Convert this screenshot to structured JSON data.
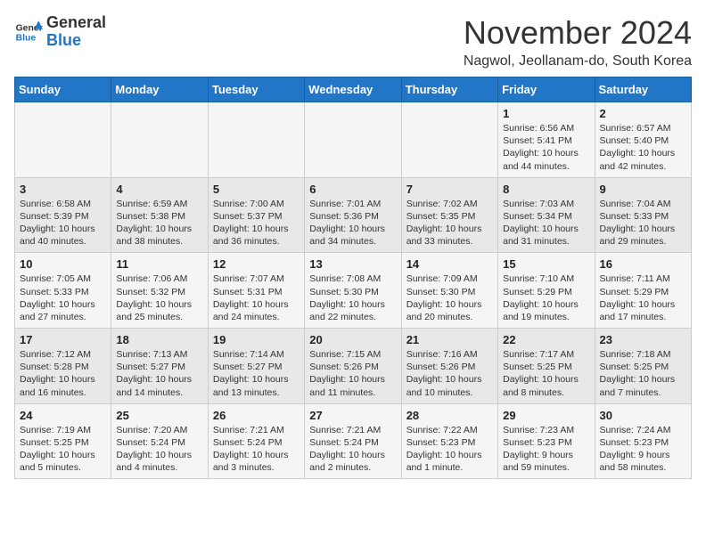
{
  "header": {
    "logo_general": "General",
    "logo_blue": "Blue",
    "month_title": "November 2024",
    "location": "Nagwol, Jeollanam-do, South Korea"
  },
  "weekdays": [
    "Sunday",
    "Monday",
    "Tuesday",
    "Wednesday",
    "Thursday",
    "Friday",
    "Saturday"
  ],
  "weeks": [
    [
      {
        "day": "",
        "info": ""
      },
      {
        "day": "",
        "info": ""
      },
      {
        "day": "",
        "info": ""
      },
      {
        "day": "",
        "info": ""
      },
      {
        "day": "",
        "info": ""
      },
      {
        "day": "1",
        "info": "Sunrise: 6:56 AM\nSunset: 5:41 PM\nDaylight: 10 hours\nand 44 minutes."
      },
      {
        "day": "2",
        "info": "Sunrise: 6:57 AM\nSunset: 5:40 PM\nDaylight: 10 hours\nand 42 minutes."
      }
    ],
    [
      {
        "day": "3",
        "info": "Sunrise: 6:58 AM\nSunset: 5:39 PM\nDaylight: 10 hours\nand 40 minutes."
      },
      {
        "day": "4",
        "info": "Sunrise: 6:59 AM\nSunset: 5:38 PM\nDaylight: 10 hours\nand 38 minutes."
      },
      {
        "day": "5",
        "info": "Sunrise: 7:00 AM\nSunset: 5:37 PM\nDaylight: 10 hours\nand 36 minutes."
      },
      {
        "day": "6",
        "info": "Sunrise: 7:01 AM\nSunset: 5:36 PM\nDaylight: 10 hours\nand 34 minutes."
      },
      {
        "day": "7",
        "info": "Sunrise: 7:02 AM\nSunset: 5:35 PM\nDaylight: 10 hours\nand 33 minutes."
      },
      {
        "day": "8",
        "info": "Sunrise: 7:03 AM\nSunset: 5:34 PM\nDaylight: 10 hours\nand 31 minutes."
      },
      {
        "day": "9",
        "info": "Sunrise: 7:04 AM\nSunset: 5:33 PM\nDaylight: 10 hours\nand 29 minutes."
      }
    ],
    [
      {
        "day": "10",
        "info": "Sunrise: 7:05 AM\nSunset: 5:33 PM\nDaylight: 10 hours\nand 27 minutes."
      },
      {
        "day": "11",
        "info": "Sunrise: 7:06 AM\nSunset: 5:32 PM\nDaylight: 10 hours\nand 25 minutes."
      },
      {
        "day": "12",
        "info": "Sunrise: 7:07 AM\nSunset: 5:31 PM\nDaylight: 10 hours\nand 24 minutes."
      },
      {
        "day": "13",
        "info": "Sunrise: 7:08 AM\nSunset: 5:30 PM\nDaylight: 10 hours\nand 22 minutes."
      },
      {
        "day": "14",
        "info": "Sunrise: 7:09 AM\nSunset: 5:30 PM\nDaylight: 10 hours\nand 20 minutes."
      },
      {
        "day": "15",
        "info": "Sunrise: 7:10 AM\nSunset: 5:29 PM\nDaylight: 10 hours\nand 19 minutes."
      },
      {
        "day": "16",
        "info": "Sunrise: 7:11 AM\nSunset: 5:29 PM\nDaylight: 10 hours\nand 17 minutes."
      }
    ],
    [
      {
        "day": "17",
        "info": "Sunrise: 7:12 AM\nSunset: 5:28 PM\nDaylight: 10 hours\nand 16 minutes."
      },
      {
        "day": "18",
        "info": "Sunrise: 7:13 AM\nSunset: 5:27 PM\nDaylight: 10 hours\nand 14 minutes."
      },
      {
        "day": "19",
        "info": "Sunrise: 7:14 AM\nSunset: 5:27 PM\nDaylight: 10 hours\nand 13 minutes."
      },
      {
        "day": "20",
        "info": "Sunrise: 7:15 AM\nSunset: 5:26 PM\nDaylight: 10 hours\nand 11 minutes."
      },
      {
        "day": "21",
        "info": "Sunrise: 7:16 AM\nSunset: 5:26 PM\nDaylight: 10 hours\nand 10 minutes."
      },
      {
        "day": "22",
        "info": "Sunrise: 7:17 AM\nSunset: 5:25 PM\nDaylight: 10 hours\nand 8 minutes."
      },
      {
        "day": "23",
        "info": "Sunrise: 7:18 AM\nSunset: 5:25 PM\nDaylight: 10 hours\nand 7 minutes."
      }
    ],
    [
      {
        "day": "24",
        "info": "Sunrise: 7:19 AM\nSunset: 5:25 PM\nDaylight: 10 hours\nand 5 minutes."
      },
      {
        "day": "25",
        "info": "Sunrise: 7:20 AM\nSunset: 5:24 PM\nDaylight: 10 hours\nand 4 minutes."
      },
      {
        "day": "26",
        "info": "Sunrise: 7:21 AM\nSunset: 5:24 PM\nDaylight: 10 hours\nand 3 minutes."
      },
      {
        "day": "27",
        "info": "Sunrise: 7:21 AM\nSunset: 5:24 PM\nDaylight: 10 hours\nand 2 minutes."
      },
      {
        "day": "28",
        "info": "Sunrise: 7:22 AM\nSunset: 5:23 PM\nDaylight: 10 hours\nand 1 minute."
      },
      {
        "day": "29",
        "info": "Sunrise: 7:23 AM\nSunset: 5:23 PM\nDaylight: 9 hours\nand 59 minutes."
      },
      {
        "day": "30",
        "info": "Sunrise: 7:24 AM\nSunset: 5:23 PM\nDaylight: 9 hours\nand 58 minutes."
      }
    ]
  ]
}
